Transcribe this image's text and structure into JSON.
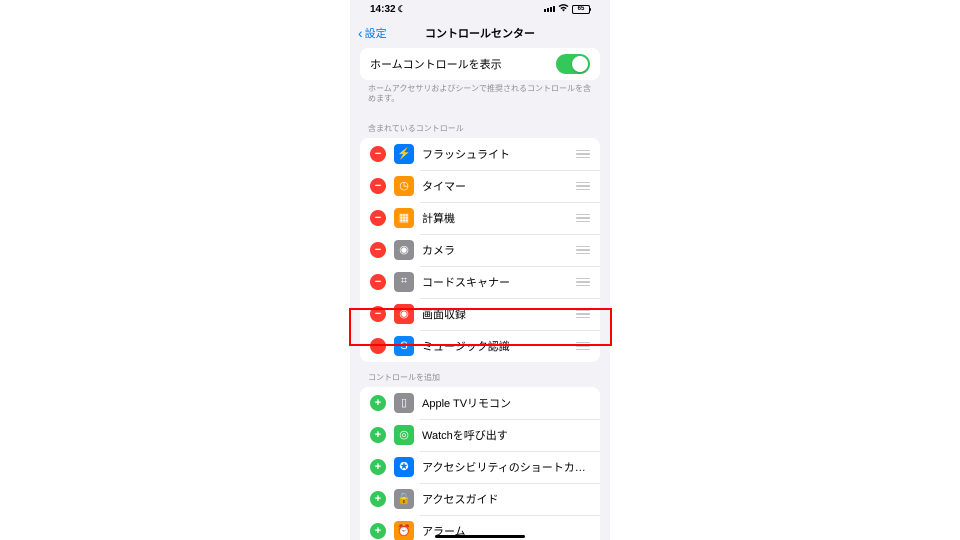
{
  "status": {
    "time": "14:32",
    "battery": "65"
  },
  "nav": {
    "back": "設定",
    "title": "コントロールセンター"
  },
  "home_control": {
    "label": "ホームコントロールを表示",
    "footer": "ホームアクセサリおよびシーンで推奨されるコントロールを含めます。"
  },
  "sections": {
    "included_header": "含まれているコントロール",
    "more_header": "コントロールを追加"
  },
  "included": [
    {
      "label": "フラッシュライト",
      "icon_bg": "#007aff",
      "glyph": "⚡"
    },
    {
      "label": "タイマー",
      "icon_bg": "#ff9500",
      "glyph": "◷"
    },
    {
      "label": "計算機",
      "icon_bg": "#ff9500",
      "glyph": "▦"
    },
    {
      "label": "カメラ",
      "icon_bg": "#8e8e93",
      "glyph": "◉"
    },
    {
      "label": "コードスキャナー",
      "icon_bg": "#8e8e93",
      "glyph": "⌗"
    },
    {
      "label": "画面収録",
      "icon_bg": "#ff3b30",
      "glyph": "◉"
    },
    {
      "label": "ミュージック認識",
      "icon_bg": "#0a84ff",
      "glyph": "S"
    }
  ],
  "more": [
    {
      "label": "Apple TVリモコン",
      "icon_bg": "#8e8e93",
      "glyph": "▯"
    },
    {
      "label": "Watchを呼び出す",
      "icon_bg": "#34c759",
      "glyph": "◎"
    },
    {
      "label": "アクセシビリティのショートカ…",
      "icon_bg": "#007aff",
      "glyph": "✪"
    },
    {
      "label": "アクセスガイド",
      "icon_bg": "#8e8e93",
      "glyph": "🔒"
    },
    {
      "label": "アラーム",
      "icon_bg": "#ff9500",
      "glyph": "⏰"
    }
  ]
}
